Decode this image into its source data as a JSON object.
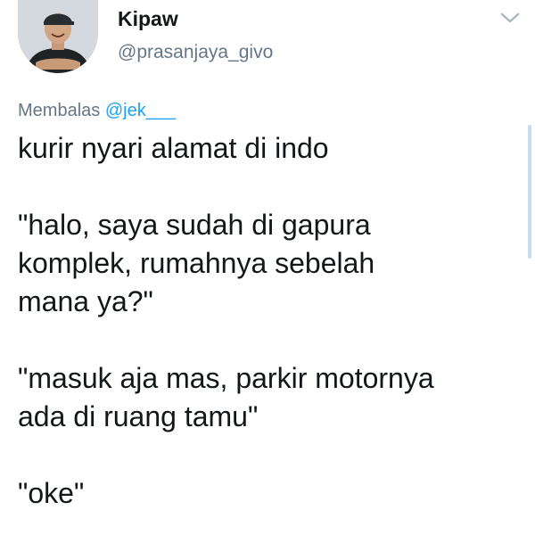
{
  "tweet": {
    "display_name": "Kipaw",
    "handle": "@prasanjaya_givo",
    "avatar_icon": "profile-photo",
    "menu_icon": "chevron-down-icon",
    "reply_prefix": "Membalas",
    "reply_to": "@jek___",
    "paragraphs": [
      "kurir nyari alamat di indo",
      "\"halo, saya sudah di gapura\nkomplek, rumahnya sebelah\nmana ya?\"",
      "\"masuk aja mas, parkir motornya\nada di ruang tamu\"",
      "\"oke\""
    ]
  },
  "colors": {
    "text": "#14171a",
    "secondary": "#657786",
    "link": "#1da1f2"
  }
}
